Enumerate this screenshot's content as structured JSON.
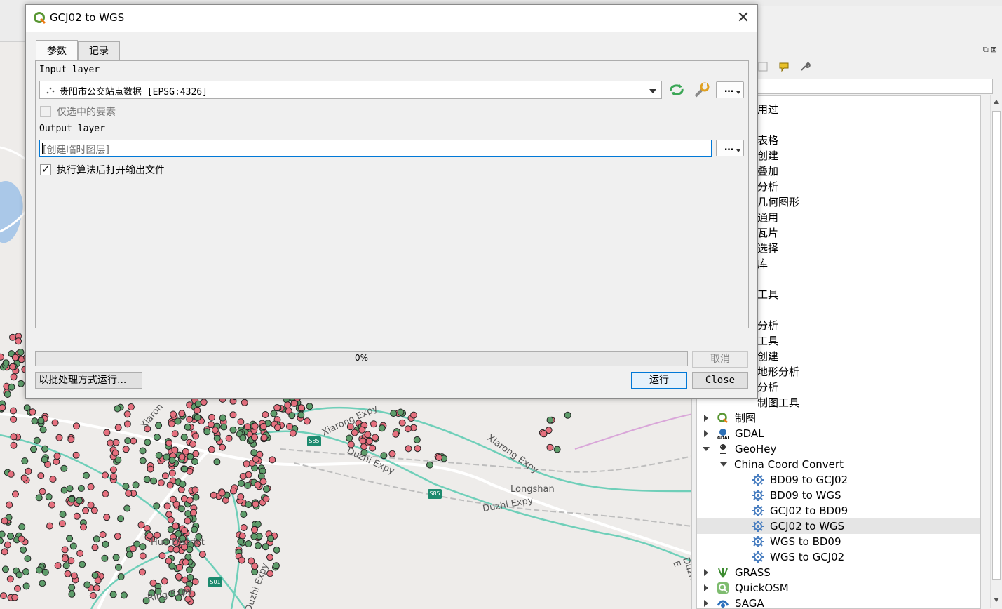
{
  "dialog": {
    "title": "GCJ02 to WGS",
    "tabs": [
      {
        "label": "参数",
        "active": true
      },
      {
        "label": "记录",
        "active": false
      }
    ],
    "input_layer": {
      "label": "Input layer",
      "value": "贵阳市公交站点数据 [EPSG:4326]"
    },
    "selected_only": {
      "label": "仅选中的要素",
      "checked": false,
      "enabled": false
    },
    "output_layer": {
      "label": "Output layer",
      "placeholder": "[创建临时图层]"
    },
    "open_output": {
      "label": "执行算法后打开输出文件",
      "checked": true
    },
    "progress": {
      "value_percent": 0,
      "text": "0%"
    },
    "buttons": {
      "cancel": "取消",
      "batch": "以批处理方式运行...",
      "run": "运行",
      "close": "Close"
    },
    "dots_label": "…"
  },
  "toolbox": {
    "partial_items": [
      "用过",
      "表格",
      "创建",
      "叠加",
      "分析",
      "几何图形",
      "通用",
      "瓦片",
      "选择",
      "库",
      "工具",
      "分析",
      "工具",
      "创建",
      "地形分析",
      "分析",
      "制图工具"
    ],
    "providers": [
      {
        "label": "制图",
        "icon": "qgis-icon",
        "expanded": false
      },
      {
        "label": "GDAL",
        "icon": "gdal-icon",
        "expanded": false
      },
      {
        "label": "GeoHey",
        "icon": "geohey-icon",
        "expanded": true
      }
    ],
    "geohey_group": "China Coord Convert",
    "algorithms": [
      {
        "label": "BD09 to GCJ02",
        "selected": false
      },
      {
        "label": "BD09 to WGS",
        "selected": false
      },
      {
        "label": "GCJ02 to BD09",
        "selected": false
      },
      {
        "label": "GCJ02 to WGS",
        "selected": true
      },
      {
        "label": "WGS to BD09",
        "selected": false
      },
      {
        "label": "WGS to GCJ02",
        "selected": false
      }
    ],
    "more_providers": [
      {
        "label": "GRASS",
        "icon": "grass-icon"
      },
      {
        "label": "QuickOSM",
        "icon": "quickosm-icon"
      },
      {
        "label": "SAGA",
        "icon": "saga-icon"
      }
    ]
  },
  "map": {
    "labels": [
      "Xiaron",
      "Xiarong Expy",
      "Duzhi Expy",
      "Xiarong Expy",
      "Longshan",
      "Duzhi Expy",
      "Hua District",
      "Ring Expy",
      "Duzhi Expy",
      "Duzhi E"
    ],
    "shields": [
      "S85",
      "S85",
      "S01"
    ],
    "colors": {
      "point_fill": "#e5707e",
      "point_alt": "#5e9c6a",
      "highway": "#6fcfb9"
    }
  }
}
